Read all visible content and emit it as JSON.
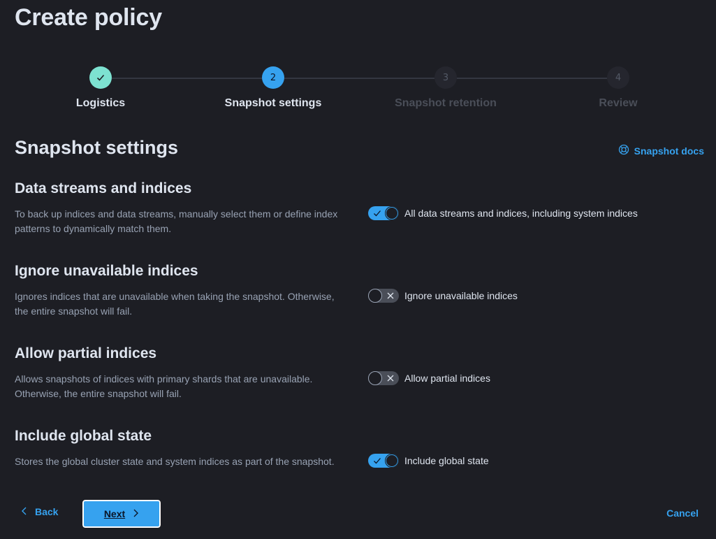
{
  "page_title": "Create policy",
  "stepper": {
    "steps": [
      {
        "number": "1",
        "label": "Logistics",
        "status": "complete"
      },
      {
        "number": "2",
        "label": "Snapshot settings",
        "status": "current"
      },
      {
        "number": "3",
        "label": "Snapshot retention",
        "status": "incomplete"
      },
      {
        "number": "4",
        "label": "Review",
        "status": "incomplete"
      }
    ]
  },
  "section": {
    "title": "Snapshot settings",
    "docs_link": "Snapshot docs"
  },
  "fields": [
    {
      "title": "Data streams and indices",
      "description": "To back up indices and data streams, manually select them or define index patterns to dynamically match them.",
      "switch_label": "All data streams and indices, including system indices",
      "checked": true
    },
    {
      "title": "Ignore unavailable indices",
      "description": "Ignores indices that are unavailable when taking the snapshot. Otherwise, the entire snapshot will fail.",
      "switch_label": "Ignore unavailable indices",
      "checked": false
    },
    {
      "title": "Allow partial indices",
      "description": "Allows snapshots of indices with primary shards that are unavailable. Otherwise, the entire snapshot will fail.",
      "switch_label": "Allow partial indices",
      "checked": false
    },
    {
      "title": "Include global state",
      "description": "Stores the global cluster state and system indices as part of the snapshot.",
      "switch_label": "Include global state",
      "checked": true
    }
  ],
  "footer": {
    "back_label": "Back",
    "next_label": "Next",
    "cancel_label": "Cancel"
  },
  "colors": {
    "background": "#1d1e24",
    "accent": "#36a2ef",
    "success": "#7de2d1"
  }
}
